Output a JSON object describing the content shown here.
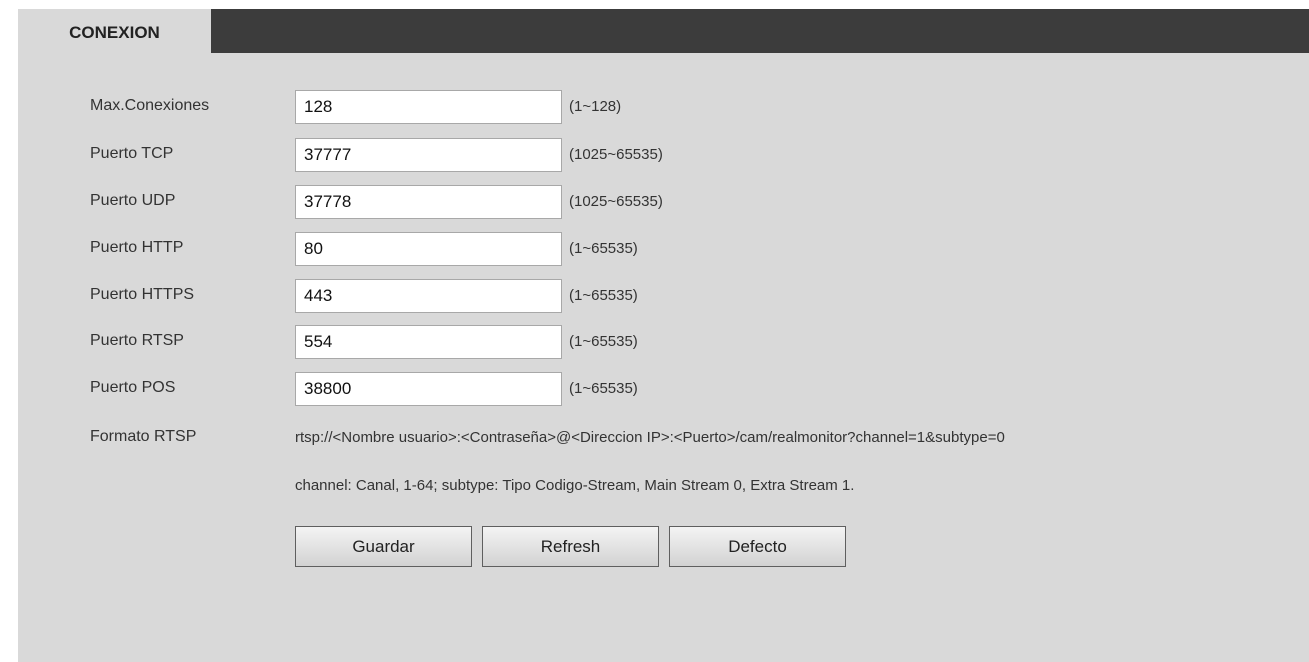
{
  "tab": {
    "title": "CONEXION"
  },
  "fields": [
    {
      "label": "Max.Conexiones",
      "value": "128",
      "range": "(1~128)"
    },
    {
      "label": "Puerto TCP",
      "value": "37777",
      "range": "(1025~65535)"
    },
    {
      "label": "Puerto UDP",
      "value": "37778",
      "range": "(1025~65535)"
    },
    {
      "label": "Puerto HTTP",
      "value": "80",
      "range": "(1~65535)"
    },
    {
      "label": "Puerto HTTPS",
      "value": "443",
      "range": "(1~65535)"
    },
    {
      "label": "Puerto RTSP",
      "value": "554",
      "range": "(1~65535)"
    },
    {
      "label": "Puerto POS",
      "value": "38800",
      "range": "(1~65535)"
    }
  ],
  "rtsp": {
    "label": "Formato RTSP",
    "format": "rtsp://<Nombre usuario>:<Contraseña>@<Direccion IP>:<Puerto>/cam/realmonitor?channel=1&subtype=0",
    "note": "channel: Canal, 1-64; subtype: Tipo Codigo-Stream, Main Stream 0, Extra Stream 1."
  },
  "buttons": {
    "save": "Guardar",
    "refresh": "Refresh",
    "default": "Defecto"
  }
}
